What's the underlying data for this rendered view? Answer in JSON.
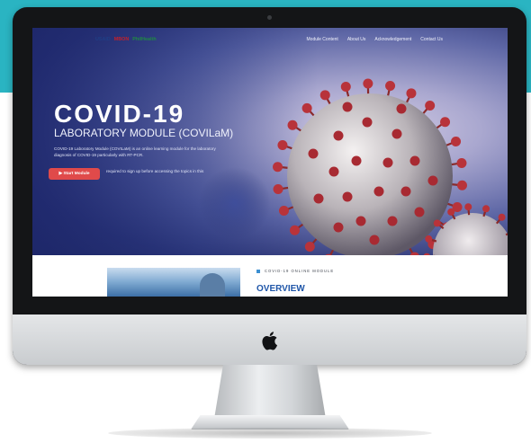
{
  "navbar": {
    "logos": [
      "USAID",
      "MBON",
      "PhilHealth"
    ],
    "menu": [
      "Module Content",
      "About Us",
      "Acknowledgement",
      "Contact Us"
    ]
  },
  "hero": {
    "title": "COVID-19",
    "subtitle": "LABORATORY MODULE (COVILaM)",
    "description": "COVID-19 Laboratory Module (COVILaM) is an online learning module for the laboratory diagnosis of COVID-19 particularly with RT-PCR.",
    "start_button": "▶ Start Module",
    "note": "required to sign up before accessing the topics in this"
  },
  "content": {
    "module_tag": "COVID-19 ONLINE MODULE",
    "overview_heading": "OVERVIEW"
  },
  "colors": {
    "teal_band": "#2ab4c2",
    "start_button": "#e04a4a",
    "overview_heading": "#1e55a8"
  }
}
